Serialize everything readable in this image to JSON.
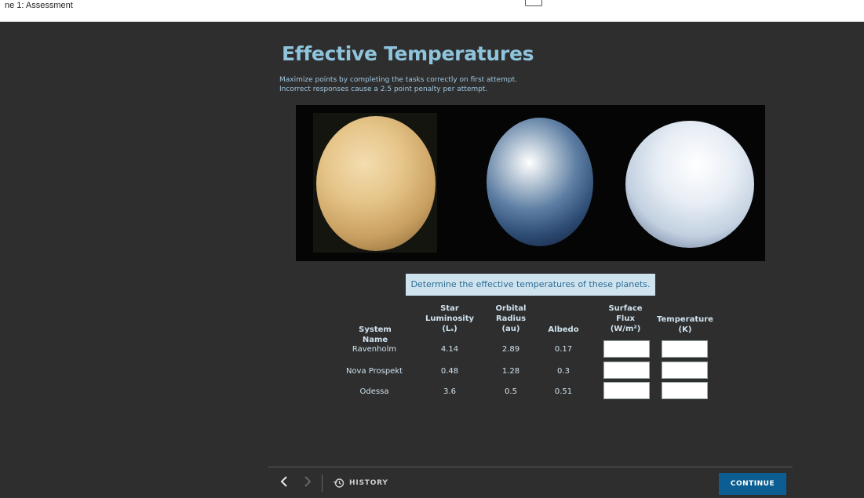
{
  "topbar": {
    "title": "ne 1: Assessment"
  },
  "page": {
    "heading": "Effective Temperatures",
    "instructions": [
      "Maximize points by completing the tasks correctly on first attempt.",
      "Incorrect responses cause a 2.5 point penalty per attempt."
    ],
    "image": {
      "planets": [
        "venus",
        "earth",
        "snowball-earth"
      ]
    },
    "prompt": "Determine the effective temperatures of these planets."
  },
  "table": {
    "headers": {
      "system": "System Name",
      "luminosity": [
        "Star",
        "Luminosity",
        "(Lₛ)"
      ],
      "radius": [
        "Orbital",
        "Radius",
        "(au)"
      ],
      "albedo": "Albedo",
      "flux": [
        "Surface",
        "Flux",
        "(W/m²)"
      ],
      "temperature": [
        "Temperature",
        "(K)"
      ]
    },
    "rows": [
      {
        "name": "Ravenholm",
        "luminosity": "4.14",
        "radius": "2.89",
        "albedo": "0.17",
        "flux": "",
        "temperature": ""
      },
      {
        "name": "Nova Prospekt",
        "luminosity": "0.48",
        "radius": "1.28",
        "albedo": "0.3",
        "flux": "",
        "temperature": ""
      },
      {
        "name": "Odessa",
        "luminosity": "3.6",
        "radius": "0.5",
        "albedo": "0.51",
        "flux": "",
        "temperature": ""
      }
    ]
  },
  "footer": {
    "back_icon": "chevron-left-icon",
    "forward_icon": "chevron-right-icon",
    "history_icon": "history-icon",
    "history_label": "HISTORY",
    "continue_label": "CONTINUE"
  },
  "colors": {
    "accent": "#0c5e92",
    "heading": "#8ec4dc",
    "prompt_bg": "#cfe3ef",
    "background": "#2e2e2e"
  }
}
